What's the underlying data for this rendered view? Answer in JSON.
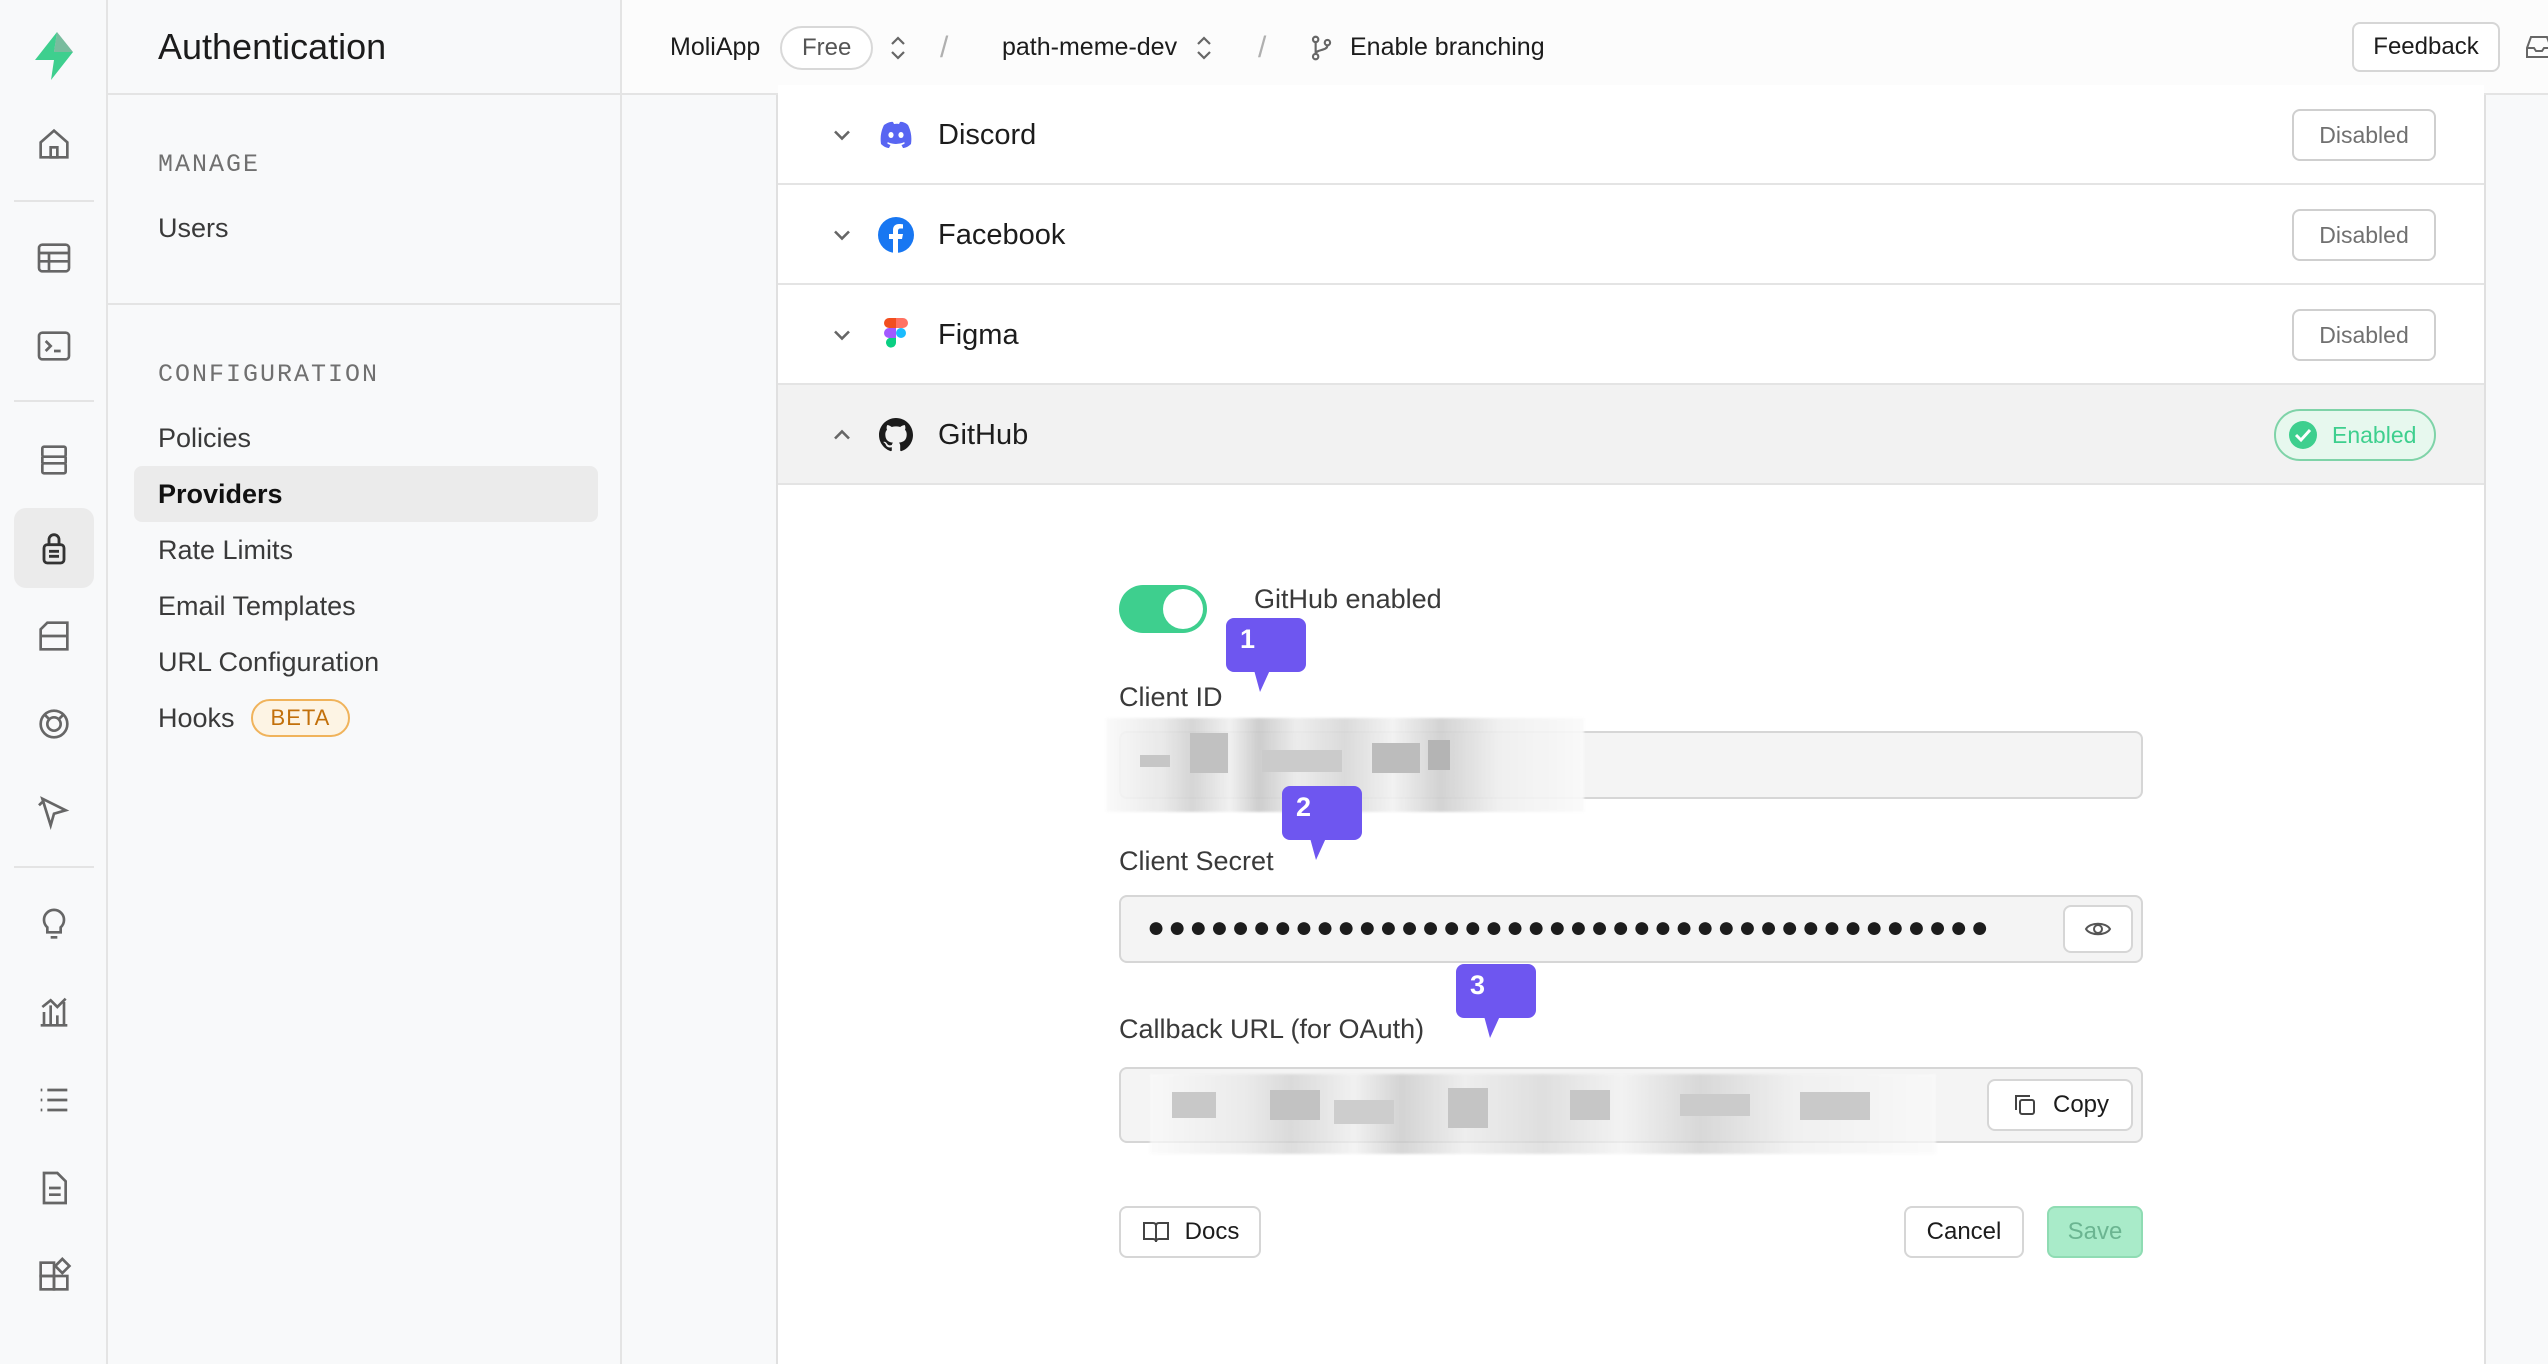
{
  "sidebar": {
    "title": "Authentication",
    "manage_label": "MANAGE",
    "manage_items": [
      {
        "label": "Users"
      }
    ],
    "configuration_label": "CONFIGURATION",
    "config_items": [
      {
        "label": "Policies"
      },
      {
        "label": "Providers",
        "active": true
      },
      {
        "label": "Rate Limits"
      },
      {
        "label": "Email Templates"
      },
      {
        "label": "URL Configuration"
      },
      {
        "label": "Hooks",
        "badge": "BETA"
      }
    ]
  },
  "topbar": {
    "org": "MoliApp",
    "plan": "Free",
    "project": "path-meme-dev",
    "branching": "Enable branching",
    "feedback": "Feedback"
  },
  "providers": [
    {
      "name": "Discord",
      "status": "Disabled",
      "icon": "discord-icon"
    },
    {
      "name": "Facebook",
      "status": "Disabled",
      "icon": "facebook-icon"
    },
    {
      "name": "Figma",
      "status": "Disabled",
      "icon": "figma-icon"
    },
    {
      "name": "GitHub",
      "status": "Enabled",
      "icon": "github-icon",
      "expanded": true
    }
  ],
  "github_form": {
    "toggle_label": "GitHub enabled",
    "toggle_on": true,
    "client_id_label": "Client ID",
    "client_id_value": "",
    "client_secret_label": "Client Secret",
    "client_secret_masked": "●●●●●●●●●●●●●●●●●●●●●●●●●●●●●●●●●●●●●●●●",
    "callback_label": "Callback URL (for OAuth)",
    "callback_value": "",
    "copy_label": "Copy",
    "docs_label": "Docs",
    "cancel_label": "Cancel",
    "save_label": "Save"
  },
  "annotations": [
    "1",
    "2",
    "3"
  ],
  "colors": {
    "brand": "#3ecf8e",
    "annotation": "#6e56f0",
    "beta": "#c2700b"
  }
}
